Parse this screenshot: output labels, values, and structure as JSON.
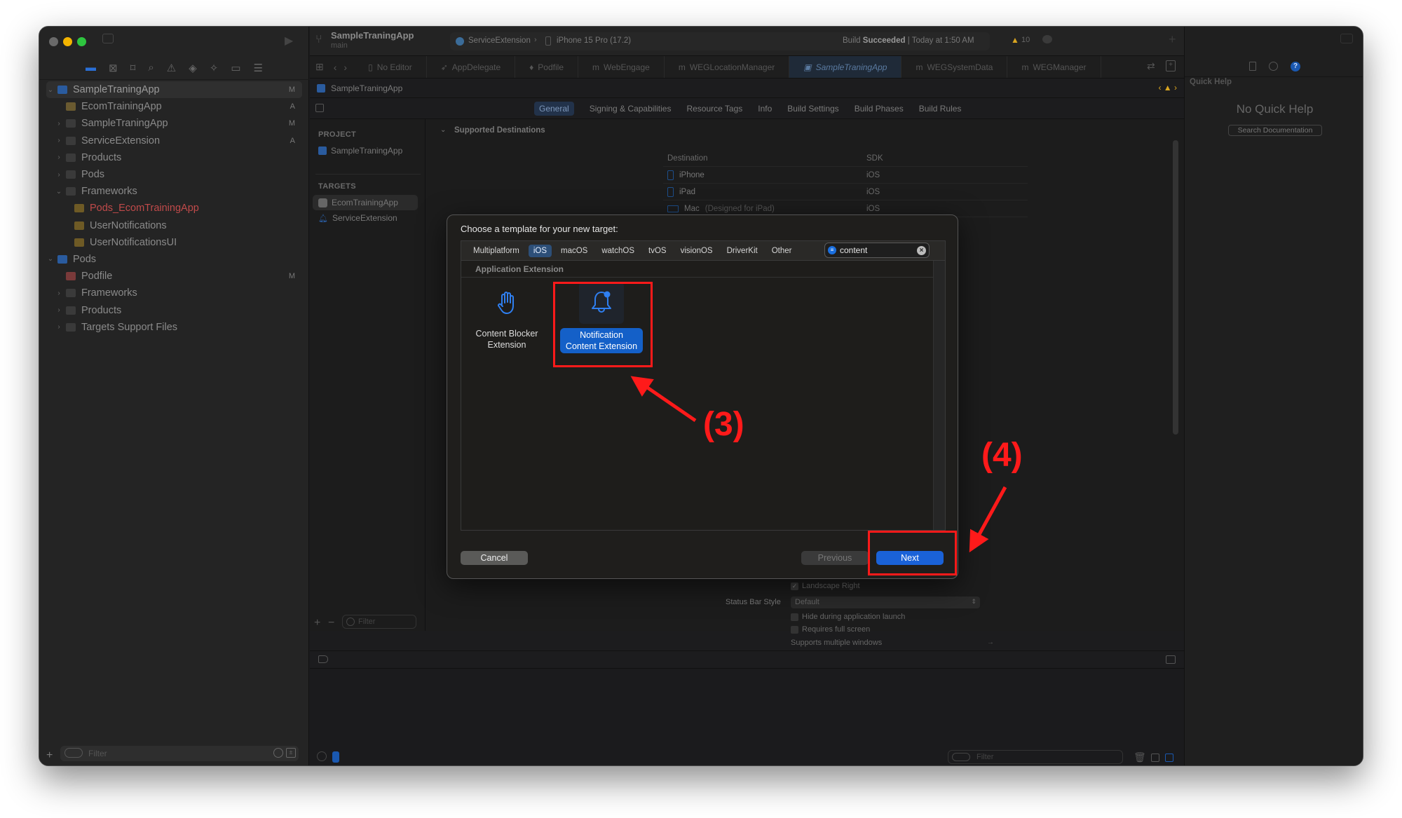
{
  "window": {
    "project_title": "SampleTraningApp",
    "branch": "main",
    "scheme": "ServiceExtension",
    "device": "iPhone 15 Pro (17.2)",
    "build_status_prefix": "Build",
    "build_status": "Succeeded",
    "build_time": "| Today at 1:50 AM",
    "warnings_count": "10"
  },
  "editor_tabs": [
    {
      "label": "No Editor",
      "icon": "doc-icon"
    },
    {
      "label": "AppDelegate",
      "icon": "swift-icon"
    },
    {
      "label": "Podfile",
      "icon": "ruby-icon"
    },
    {
      "label": "WebEngage",
      "icon": "m-file-icon"
    },
    {
      "label": "WEGLocationManager",
      "icon": "m-file-icon"
    },
    {
      "label": "SampleTraningApp",
      "icon": "project-icon",
      "active": true
    },
    {
      "label": "WEGSystemData",
      "icon": "m-file-icon"
    },
    {
      "label": "WEGManager",
      "icon": "m-file-icon"
    }
  ],
  "jump_bar": {
    "label": "SampleTraningApp"
  },
  "settings_tabs": [
    "General",
    "Signing & Capabilities",
    "Resource Tags",
    "Info",
    "Build Settings",
    "Build Phases",
    "Build Rules"
  ],
  "navigator": {
    "tree": [
      {
        "label": "SampleTraningApp",
        "level": 0,
        "chevron": "down",
        "icon": "project-icon",
        "badge": "M",
        "selected": true
      },
      {
        "label": "EcomTrainingApp",
        "level": 1,
        "chevron": "",
        "icon": "target-icon",
        "badge": "A"
      },
      {
        "label": "SampleTraningApp",
        "level": 1,
        "chevron": "right",
        "icon": "folder-icon",
        "badge": "M"
      },
      {
        "label": "ServiceExtension",
        "level": 1,
        "chevron": "right",
        "icon": "folder-icon",
        "badge": "A"
      },
      {
        "label": "Products",
        "level": 1,
        "chevron": "right",
        "icon": "folder-icon",
        "badge": ""
      },
      {
        "label": "Pods",
        "level": 1,
        "chevron": "right",
        "icon": "folder-icon",
        "badge": ""
      },
      {
        "label": "Frameworks",
        "level": 1,
        "chevron": "down",
        "icon": "folder-icon",
        "badge": ""
      },
      {
        "label": "Pods_EcomTrainingApp",
        "level": 2,
        "chevron": "",
        "icon": "framework-icon",
        "badge": "",
        "missing": true
      },
      {
        "label": "UserNotifications",
        "level": 2,
        "chevron": "",
        "icon": "framework-icon",
        "badge": ""
      },
      {
        "label": "UserNotificationsUI",
        "level": 2,
        "chevron": "",
        "icon": "framework-icon",
        "badge": ""
      },
      {
        "label": "Pods",
        "level": 0,
        "chevron": "down",
        "icon": "project-icon",
        "badge": ""
      },
      {
        "label": "Podfile",
        "level": 1,
        "chevron": "",
        "icon": "ruby-icon",
        "badge": "M"
      },
      {
        "label": "Frameworks",
        "level": 1,
        "chevron": "right",
        "icon": "folder-icon",
        "badge": ""
      },
      {
        "label": "Products",
        "level": 1,
        "chevron": "right",
        "icon": "folder-icon",
        "badge": ""
      },
      {
        "label": "Targets Support Files",
        "level": 1,
        "chevron": "right",
        "icon": "folder-icon",
        "badge": ""
      }
    ],
    "filter_placeholder": "Filter"
  },
  "project_list": {
    "project_heading": "PROJECT",
    "project": "SampleTraningApp",
    "targets_heading": "TARGETS",
    "targets": [
      "EcomTrainingApp",
      "ServiceExtension"
    ],
    "filter_placeholder": "Filter"
  },
  "general": {
    "section": "Supported Destinations",
    "columns": [
      "Destination",
      "SDK"
    ],
    "destinations": [
      {
        "name": "iPhone",
        "suffix": "",
        "sdk": "iOS"
      },
      {
        "name": "iPad",
        "suffix": "",
        "sdk": "iOS"
      },
      {
        "name": "Mac",
        "suffix": "(Designed for iPad)",
        "sdk": "iOS"
      }
    ],
    "landscape_right": "Landscape Right",
    "status_bar_style_label": "Status Bar Style",
    "status_bar_style_value": "Default",
    "hide_launch": "Hide during application launch",
    "requires_full_screen": "Requires full screen",
    "multiple_windows": "Supports multiple windows"
  },
  "inspector": {
    "title": "Quick Help",
    "empty": "No Quick Help",
    "search_button": "Search Documentation"
  },
  "debug": {
    "filter_placeholder": "Filter"
  },
  "dialog": {
    "title": "Choose a template for your new target:",
    "platforms": [
      "Multiplatform",
      "iOS",
      "macOS",
      "watchOS",
      "tvOS",
      "visionOS",
      "DriverKit",
      "Other"
    ],
    "active_platform": "iOS",
    "search_value": "content",
    "section": "Application Extension",
    "templates": [
      {
        "line1": "Content Blocker",
        "line2": "Extension",
        "icon": "hand-icon",
        "selected": false
      },
      {
        "line1": "Notification",
        "line2": "Content Extension",
        "icon": "bell-badge-icon",
        "selected": true
      }
    ],
    "cancel": "Cancel",
    "previous": "Previous",
    "next": "Next"
  },
  "annotations": {
    "step3": "(3)",
    "step4": "(4)",
    "color": "#ff1a1a"
  },
  "colors": {
    "accent": "#1460c8",
    "window_bg": "#1c1c1e",
    "warning": "#d9a520",
    "missing_file": "#c04a4a"
  }
}
